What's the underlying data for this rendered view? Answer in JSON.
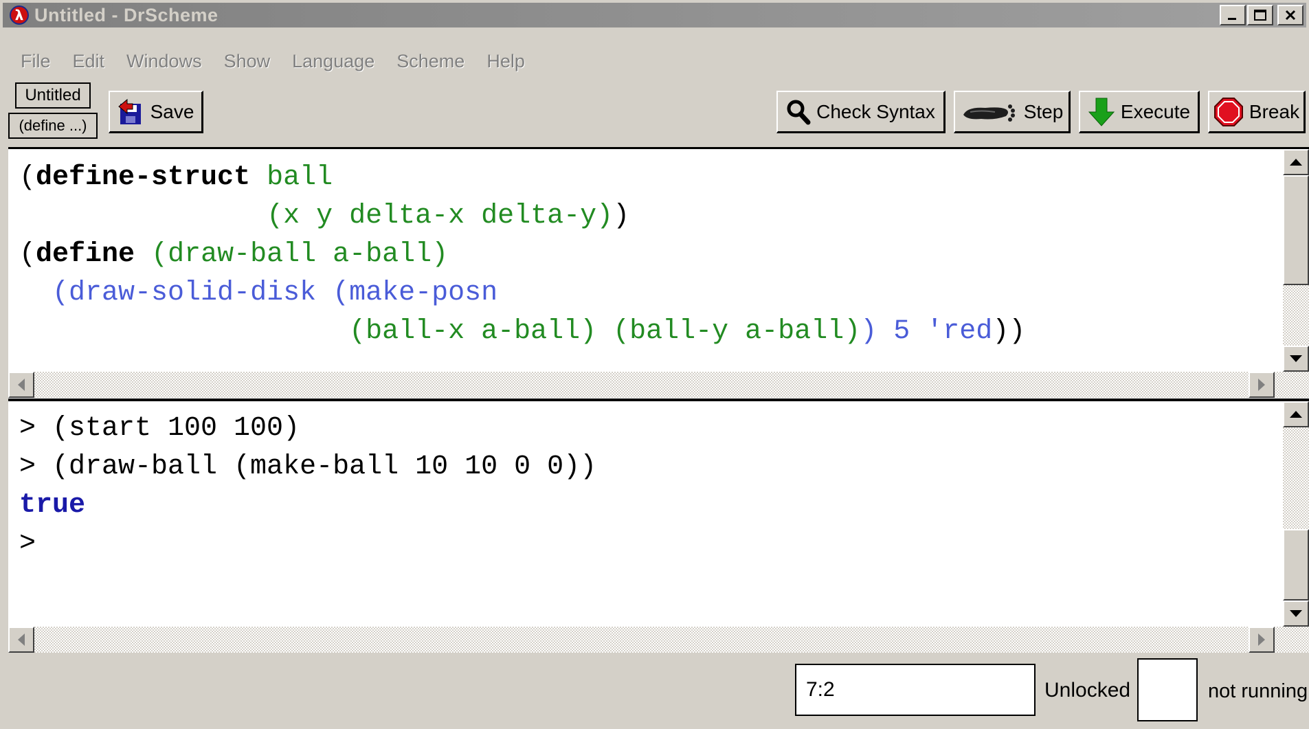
{
  "window": {
    "title": "Untitled - DrScheme",
    "controls": {
      "minimize": "_",
      "maximize": "□",
      "close": "✕"
    }
  },
  "menu": [
    "File",
    "Edit",
    "Windows",
    "Show",
    "Language",
    "Scheme",
    "Help"
  ],
  "toolbar": {
    "name_button": "Untitled",
    "define_popup": "(define ...)",
    "save_label": "Save",
    "check_syntax_label": "Check Syntax",
    "step_label": "Step",
    "execute_label": "Execute",
    "break_label": "Break"
  },
  "definitions": {
    "lines": [
      "(define-struct ball",
      "               (x y delta-x delta-y))",
      "(define (draw-ball a-ball)",
      "  (draw-solid-disk (make-posn",
      "                    (ball-x a-ball) (ball-y a-ball)) 5 'red))"
    ]
  },
  "interactions": {
    "lines": [
      "> (start 100 100)",
      "> (draw-ball (make-ball 10 10 0 0))",
      "true",
      ">"
    ]
  },
  "status": {
    "position": "7:2",
    "lock_state": "Unlocked",
    "run_state": "not running"
  },
  "colors": {
    "keyword": "#000000",
    "identifier": "#228b22",
    "primitive": "#4a5cd8",
    "result": "#1a1aa8",
    "execute_arrow": "#1aa01a",
    "break_stop": "#e01020"
  }
}
